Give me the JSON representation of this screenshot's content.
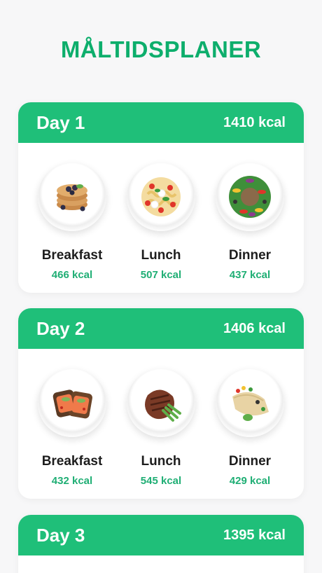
{
  "title": "MÅLTIDSPLANER",
  "colors": {
    "accent": "#1fbf79",
    "title": "#0dae6c",
    "kcal_text": "#1fae74"
  },
  "days": [
    {
      "label": "Day 1",
      "kcal": "1410 kcal",
      "meals": [
        {
          "name": "Breakfast",
          "kcal": "466 kcal",
          "icon": "pancakes-plate-icon"
        },
        {
          "name": "Lunch",
          "kcal": "507 kcal",
          "icon": "pasta-salad-plate-icon"
        },
        {
          "name": "Dinner",
          "kcal": "437 kcal",
          "icon": "tuna-salad-plate-icon"
        }
      ]
    },
    {
      "label": "Day 2",
      "kcal": "1406 kcal",
      "meals": [
        {
          "name": "Breakfast",
          "kcal": "432 kcal",
          "icon": "salmon-toast-plate-icon"
        },
        {
          "name": "Lunch",
          "kcal": "545 kcal",
          "icon": "steak-plate-icon"
        },
        {
          "name": "Dinner",
          "kcal": "429 kcal",
          "icon": "wrap-plate-icon"
        }
      ]
    },
    {
      "label": "Day 3",
      "kcal": "1395 kcal",
      "meals": []
    }
  ]
}
